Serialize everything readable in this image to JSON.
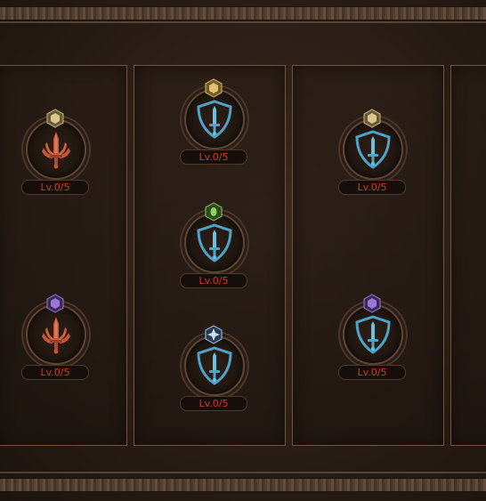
{
  "skill_tree": {
    "nodes": [
      {
        "id": "n1",
        "icon": "flame-sword-icon",
        "gem": "gold-gem",
        "level_text": "Lv.0/5"
      },
      {
        "id": "n2",
        "icon": "flame-sword-icon",
        "gem": "purple-gem",
        "level_text": "Lv.0/5"
      },
      {
        "id": "n3",
        "icon": "sword-shield-icon",
        "gem": "gold-gem",
        "level_text": "Lv.0/5"
      },
      {
        "id": "n4",
        "icon": "sword-shield-icon",
        "gem": "green-gem",
        "level_text": "Lv.0/5"
      },
      {
        "id": "n5",
        "icon": "sword-shield-icon",
        "gem": "blue-gem",
        "level_text": "Lv.0/5"
      },
      {
        "id": "n6",
        "icon": "sword-shield-icon",
        "gem": "gold-gem",
        "level_text": "Lv.0/5"
      },
      {
        "id": "n7",
        "icon": "sword-shield-icon",
        "gem": "purple-gem",
        "level_text": "Lv.0/5"
      }
    ]
  },
  "colors": {
    "level_text": "#d33a28",
    "shield_blue": "#4fa3c8",
    "flame_orange": "#d0643a",
    "panel_border": "#6d5443"
  }
}
